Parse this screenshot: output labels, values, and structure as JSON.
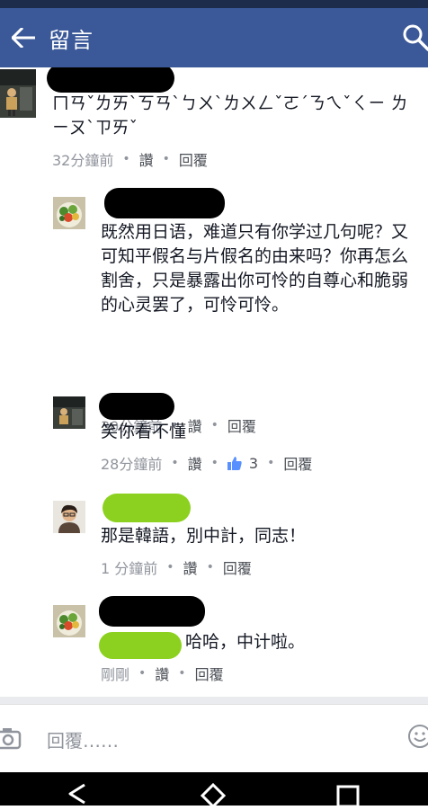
{
  "app": {
    "title": "留言"
  },
  "comments": [
    {
      "text": "ㄇㄢˇㄌㄞˋㄎㄢˋㄅㄨˋㄌㄨㄥˇㄛˊㄋㄟˇㄑㄧ ㄌㄧㄡˋㄗㄞˇ",
      "time": "32分鐘前",
      "actions": [
        "讚",
        "回覆"
      ]
    },
    {
      "text": "既然用日语，难道只有你学过几句呢？又可知平假名与片假名的由来吗？你再怎么割舍，只是暴露出你可怜的自尊心和脆弱的心灵罢了，可怜可怜。",
      "time": "30分鐘前",
      "actions": [
        "讚",
        "回覆"
      ]
    },
    {
      "text": "笑你看不懂",
      "time": "28分鐘前",
      "actions": [
        "讚",
        "回覆"
      ],
      "likes": "3"
    },
    {
      "text": "那是韓語，別中計，同志！",
      "time": "1 分鐘前",
      "actions": [
        "讚",
        "回覆"
      ]
    },
    {
      "text": "哈哈，中计啦。",
      "time": "剛剛",
      "actions": [
        "讚",
        "回覆"
      ]
    }
  ],
  "composer": {
    "placeholder": "回覆……"
  },
  "colors": {
    "brand": "#3b5998",
    "status": "#1e2c4c",
    "meta": "#90949c",
    "highlight": "#8cd11f"
  },
  "icons": [
    "back-arrow-icon",
    "search-icon",
    "camera-icon",
    "emoji-icon",
    "thumbs-up-icon",
    "nav-back-icon",
    "nav-home-icon",
    "nav-recents-icon"
  ]
}
